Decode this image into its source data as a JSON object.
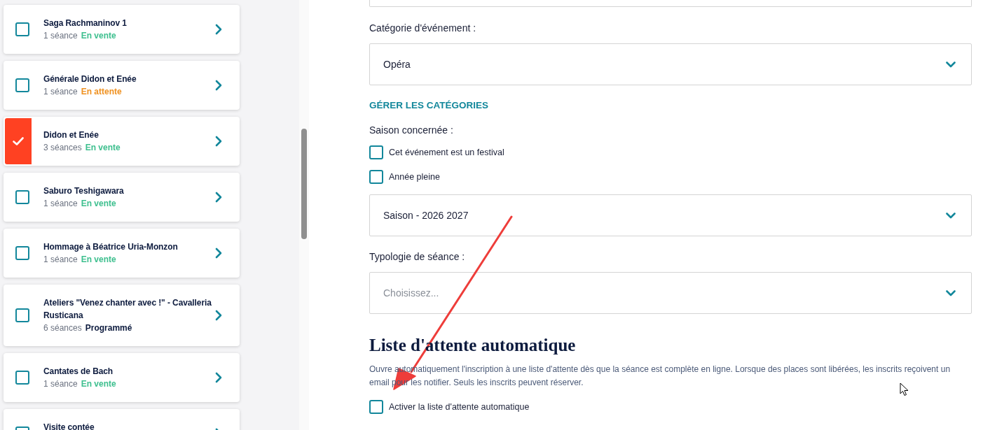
{
  "event_list": {
    "items": [
      {
        "title": "Saga Rachmaninov 1",
        "sessions": "1 séance",
        "status": {
          "label": "En vente",
          "color": "#3dbf8e"
        },
        "checked": false
      },
      {
        "title": "Générale Didon et Enée",
        "sessions": "1 séance",
        "status": {
          "label": "En attente",
          "color": "#ef9120"
        },
        "checked": false
      },
      {
        "title": "Didon et Enée",
        "sessions": "3 séances",
        "status": {
          "label": "En vente",
          "color": "#3dbf8e"
        },
        "checked": true
      },
      {
        "title": "Saburo Teshigawara",
        "sessions": "1 séance",
        "status": {
          "label": "En vente",
          "color": "#3dbf8e"
        },
        "checked": false
      },
      {
        "title": "Hommage à Béatrice Uria-Monzon",
        "sessions": "1 séance",
        "status": {
          "label": "En vente",
          "color": "#3dbf8e"
        },
        "checked": false
      },
      {
        "title": "Ateliers \"Venez chanter avec !\" - Cavalleria Rusticana",
        "sessions": "6 séances",
        "status": {
          "label": "Programmé",
          "color": "#0d1b3e"
        },
        "checked": false
      },
      {
        "title": "Cantates de Bach",
        "sessions": "1 séance",
        "status": {
          "label": "En vente",
          "color": "#3dbf8e"
        },
        "checked": false
      },
      {
        "title": "Visite contée",
        "checked": false
      }
    ]
  },
  "form": {
    "category": {
      "label": "Catégorie d'événement :",
      "value": "Opéra"
    },
    "manage_link": "GÉRER LES CATÉGORIES",
    "season": {
      "label": "Saison concernée :",
      "options": [
        {
          "label": "Cet événement est un festival",
          "checked": false
        },
        {
          "label": "Année pleine",
          "checked": false
        }
      ],
      "value": "Saison - 2026 2027"
    },
    "session_type": {
      "label": "Typologie de séance :",
      "placeholder": "Choisissez..."
    }
  },
  "waitlist": {
    "title": "Liste d'attente automatique",
    "description": "Ouvre automatiquement l'inscription à une liste d'attente dès que la séance est complète en ligne. Lorsque des places sont libérées, les inscrits reçoivent un email pour les notifier. Seuls les inscrits peuvent réserver.",
    "option": {
      "label": "Activer la liste d'attente automatique",
      "checked": false
    }
  }
}
